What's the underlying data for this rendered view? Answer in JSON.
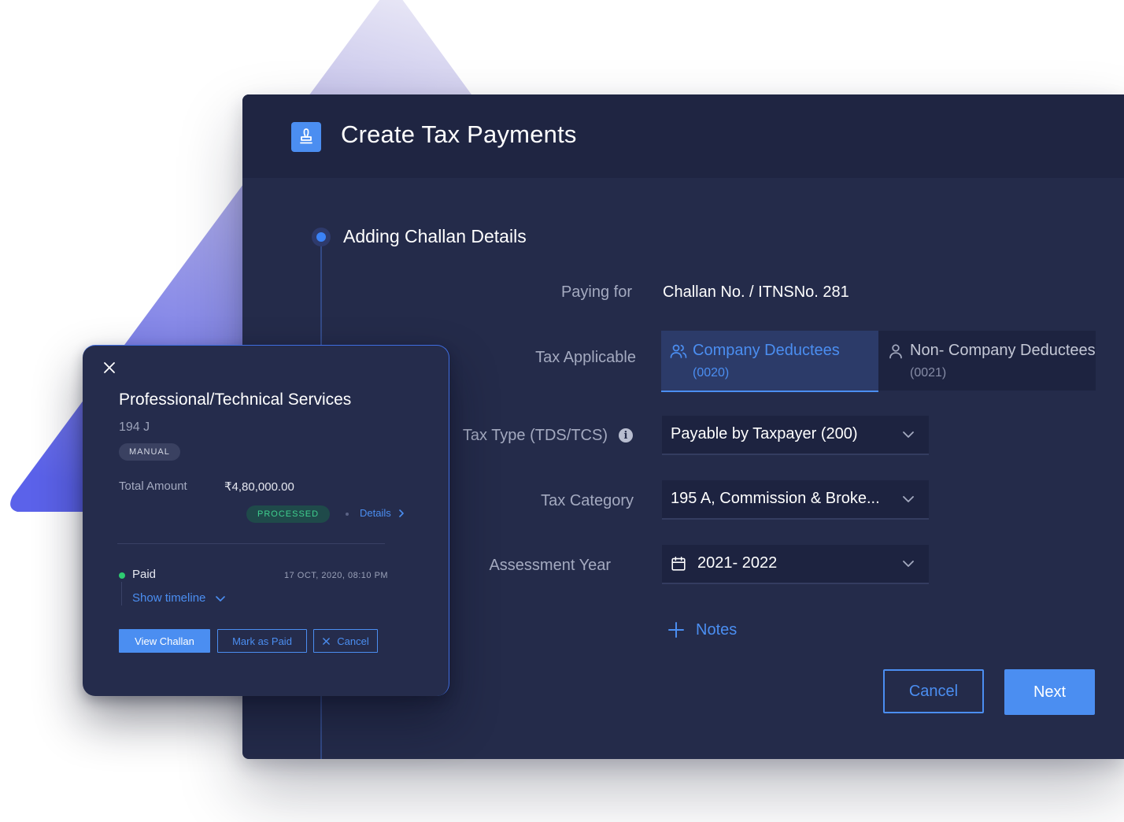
{
  "window": {
    "title": "Create Tax Payments",
    "header_icon": "stamp-icon",
    "step_title": "Adding Challan Details"
  },
  "form": {
    "paying_for": {
      "label": "Paying for",
      "value": "Challan No. / ITNSNo. 281"
    },
    "tax_applicable": {
      "label": "Tax Applicable",
      "options": [
        {
          "label": "Company Deductees",
          "code": "(0020)",
          "icon": "users-icon",
          "selected": true
        },
        {
          "label": "Non- Company Deductees",
          "code": "(0021)",
          "icon": "user-icon",
          "selected": false
        }
      ]
    },
    "tax_type": {
      "label": "Tax Type (TDS/TCS)",
      "info_icon": "info-icon",
      "value": "Payable by Taxpayer (200)"
    },
    "tax_category": {
      "label": "Tax Category",
      "value": "195 A, Commission & Broke..."
    },
    "assessment_year": {
      "label": "Assessment Year",
      "value": "2021- 2022",
      "icon": "calendar-icon"
    },
    "notes_label": "Notes"
  },
  "actions": {
    "cancel_label": "Cancel",
    "next_label": "Next"
  },
  "card": {
    "title": "Professional/Technical Services",
    "code": "194 J",
    "badge": "MANUAL",
    "total_amount_label": "Total Amount",
    "total_amount_value": "₹4,80,000.00",
    "status": "PROCESSED",
    "details_label": "Details",
    "paid_label": "Paid",
    "paid_time": "17 OCT, 2020, 08:10 PM",
    "show_timeline_label": "Show timeline",
    "buttons": {
      "view": "View Challan",
      "mark_paid": "Mark as Paid",
      "cancel": "Cancel"
    }
  },
  "colors": {
    "window_bg": "#242b4a",
    "header_bg": "#1f2542",
    "accent": "#4b8ef1",
    "success": "#3fcf8e",
    "triangle_from": "#e6e4f4",
    "triangle_to": "#5b62ea"
  }
}
